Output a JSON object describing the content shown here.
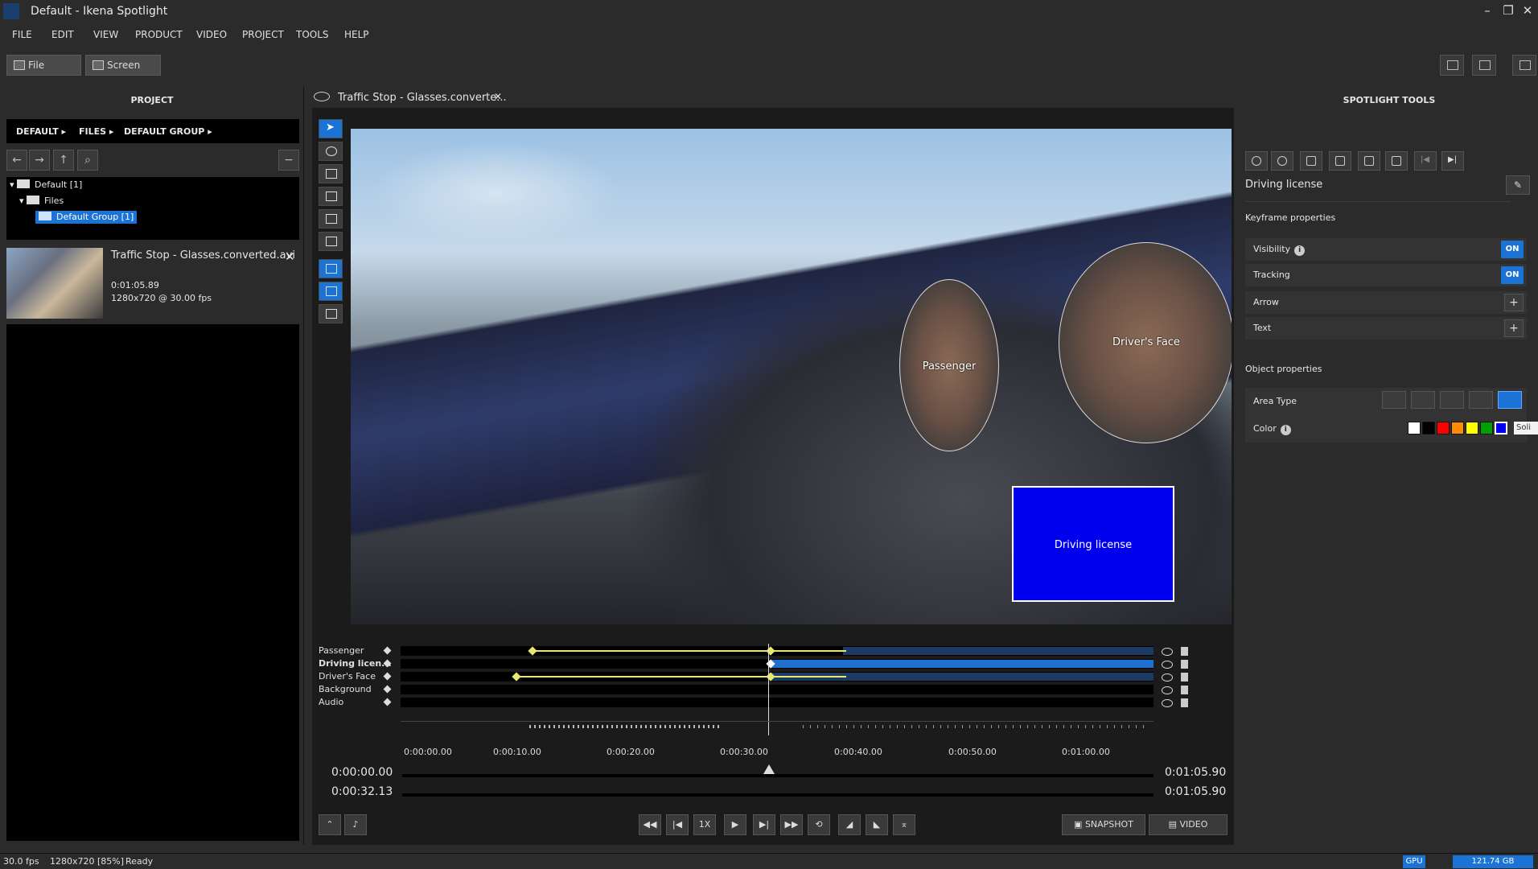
{
  "app": {
    "title": "Default - Ikena Spotlight"
  },
  "menu": [
    "FILE",
    "EDIT",
    "VIEW",
    "PRODUCT",
    "VIDEO",
    "PROJECT",
    "TOOLS",
    "HELP"
  ],
  "toolbar": {
    "file_label": "File",
    "screen_label": "Screen"
  },
  "project": {
    "header": "PROJECT",
    "crumbs": [
      "DEFAULT ▸",
      "FILES ▸",
      "DEFAULT GROUP ▸"
    ],
    "tree": [
      "Default [1]",
      "Files",
      "Default Group [1]"
    ],
    "file": {
      "name": "Traffic Stop - Glasses.converted.avi",
      "duration": "0:01:05.89",
      "info": "1280x720 @ 30.00 fps"
    }
  },
  "editor": {
    "tab_title": "Traffic Stop - Glasses.converte...",
    "objects": {
      "passenger": "Passenger",
      "driver_face": "Driver's Face",
      "license": "Driving license"
    }
  },
  "timeline": {
    "tracks": [
      "Passenger",
      "Driving licen...",
      "Driver's Face",
      "Background",
      "Audio"
    ],
    "ticks": [
      "0:00:00.00",
      "0:00:10.00",
      "0:00:20.00",
      "0:00:30.00",
      "0:00:40.00",
      "0:00:50.00",
      "0:01:00.00"
    ],
    "time_start": "0:00:00.00",
    "time_current": "0:00:32.13",
    "time_end1": "0:01:05.90",
    "time_end2": "0:01:05.90",
    "speed": "1X",
    "snapshot_label": "SNAPSHOT",
    "video_label": "VIDEO"
  },
  "tools_panel": {
    "header": "SPOTLIGHT TOOLS",
    "object_name": "Driving license",
    "keyframe_props": "Keyframe properties",
    "visibility": "Visibility",
    "visibility_state": "ON",
    "tracking": "Tracking",
    "tracking_state": "ON",
    "arrow": "Arrow",
    "text": "Text",
    "object_props": "Object properties",
    "area_type": "Area Type",
    "color": "Color",
    "tooltip": "Soli",
    "colors": [
      "#ffffff",
      "#000000",
      "#ff0000",
      "#ff8c00",
      "#ffff00",
      "#00a000",
      "#0000ee"
    ]
  },
  "status": {
    "fps": "30.0 fps",
    "res": "1280x720 [85%]",
    "state": "Ready",
    "gpu": "GPU",
    "disk": "121.74 GB"
  }
}
